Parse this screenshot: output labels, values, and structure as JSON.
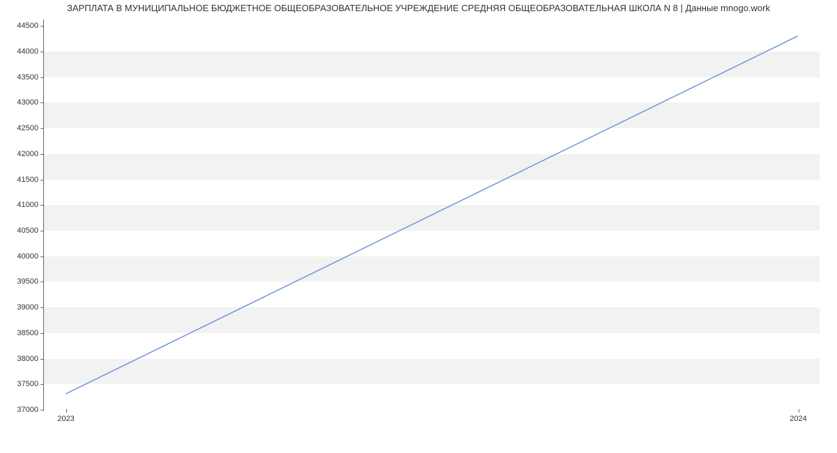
{
  "chart_data": {
    "type": "line",
    "title": "ЗАРПЛАТА В МУНИЦИПАЛЬНОЕ БЮДЖЕТНОЕ ОБЩЕОБРАЗОВАТЕЛЬНОЕ УЧРЕЖДЕНИЕ СРЕДНЯЯ ОБЩЕОБРАЗОВАТЕЛЬНАЯ ШКОЛА N 8 | Данные mnogo.work",
    "x": [
      2023,
      2024
    ],
    "values": [
      37300,
      44300
    ],
    "x_ticks": [
      2023,
      2024
    ],
    "y_ticks": [
      37000,
      37500,
      38000,
      38500,
      39000,
      39500,
      40000,
      40500,
      41000,
      41500,
      42000,
      42500,
      43000,
      43500,
      44000,
      44500
    ],
    "ylim": [
      37000,
      44625
    ],
    "xlim": [
      2022.97,
      2024.03
    ],
    "xlabel": "",
    "ylabel": "",
    "line_color": "#6f94d9"
  }
}
